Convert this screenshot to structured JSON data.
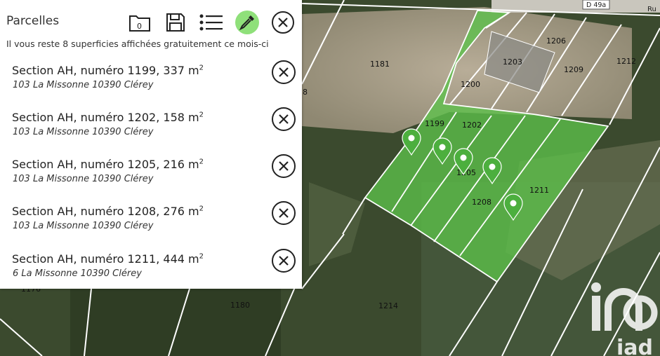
{
  "panel": {
    "title": "Parcelles",
    "subtitle": "Il vous reste 8 superficies affichées gratuitement ce mois-ci",
    "folder_count": "0",
    "items": [
      {
        "label": "Section AH, numéro 1199, 337 m",
        "sup": "2",
        "address": "103 La Missonne 10390 Clérey"
      },
      {
        "label": "Section AH, numéro 1202, 158 m",
        "sup": "2",
        "address": "103 La Missonne 10390 Clérey"
      },
      {
        "label": "Section AH, numéro 1205, 216 m",
        "sup": "2",
        "address": "103 La Missonne 10390 Clérey"
      },
      {
        "label": "Section AH, numéro 1208, 276 m",
        "sup": "2",
        "address": "103 La Missonne 10390 Clérey"
      },
      {
        "label": "Section AH, numéro 1211, 444 m",
        "sup": "2",
        "address": "6 La Missonne 10390 Clérey"
      }
    ]
  },
  "map": {
    "road_badge": "D 49a",
    "road_name": "Ru",
    "parcel_labels": [
      "1181",
      "1203",
      "1206",
      "1209",
      "1212",
      "1200",
      "1199",
      "1202",
      "1205",
      "1208",
      "1211",
      "1180",
      "1214",
      "1176",
      "8"
    ],
    "watermark": "iad",
    "colors": {
      "selected": "#5cc24a",
      "dropper_button": "#8fe07a",
      "pin": "#4caf3e"
    }
  },
  "icons": {
    "folder": "folder-icon",
    "save": "save-icon",
    "list": "list-icon",
    "dropper": "eyedropper-icon",
    "close": "close-icon",
    "pin": "map-pin-icon"
  }
}
